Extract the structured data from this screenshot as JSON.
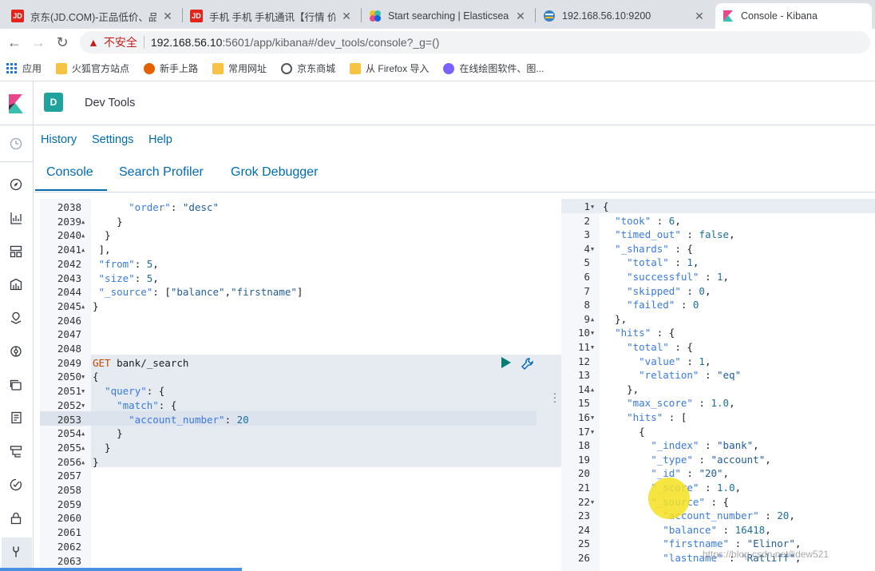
{
  "browser": {
    "tabs": [
      {
        "title": "京东(JD.COM)-正品低价、品质",
        "favicon": "JD",
        "color": "#e1251b"
      },
      {
        "title": "手机 手机 手机通讯【行情 价格",
        "favicon": "JD",
        "color": "#e1251b"
      },
      {
        "title": "Start searching | Elasticsearch",
        "favicon": "",
        "color": "#f4bd19"
      },
      {
        "title": "192.168.56.10:9200",
        "favicon": "",
        "color": "#3b82c4"
      },
      {
        "title": "Console - Kibana",
        "favicon": "K",
        "color": "#e8488b"
      }
    ],
    "address": {
      "warning": "不安全",
      "host": "192.168.56.10",
      "rest": ":5601/app/kibana#/dev_tools/console?_g=()"
    },
    "bookmarks": [
      "应用",
      "火狐官方站点",
      "新手上路",
      "常用网址",
      "京东商城",
      "从 Firefox 导入",
      "在线绘图软件、图..."
    ]
  },
  "kibana": {
    "space_initial": "D",
    "breadcrumb": "Dev Tools",
    "top_links": [
      "History",
      "Settings",
      "Help"
    ],
    "tabs": [
      "Console",
      "Search Profiler",
      "Grok Debugger"
    ],
    "active_tab": "Console"
  },
  "editor_lines": [
    {
      "n": "2038",
      "f": "",
      "code": "      \"order\": \"desc\""
    },
    {
      "n": "2039",
      "f": "▲",
      "code": "    }"
    },
    {
      "n": "2040",
      "f": "▲",
      "code": "  }"
    },
    {
      "n": "2041",
      "f": "▲",
      "code": " ],"
    },
    {
      "n": "2042",
      "f": "",
      "code": " \"from\": 5,"
    },
    {
      "n": "2043",
      "f": "",
      "code": " \"size\": 5,"
    },
    {
      "n": "2044",
      "f": "",
      "code": " \"_source\": [\"balance\",\"firstname\"]"
    },
    {
      "n": "2045",
      "f": "▲",
      "code": "}"
    },
    {
      "n": "2046",
      "f": "",
      "code": ""
    },
    {
      "n": "2047",
      "f": "",
      "code": ""
    },
    {
      "n": "2048",
      "f": "",
      "code": ""
    },
    {
      "n": "2049",
      "f": "",
      "code": "GET bank/_search"
    },
    {
      "n": "2050",
      "f": "▼",
      "code": "{"
    },
    {
      "n": "2051",
      "f": "▼",
      "code": "  \"query\": {"
    },
    {
      "n": "2052",
      "f": "▼",
      "code": "    \"match\": {"
    },
    {
      "n": "2053",
      "f": "",
      "code": "      \"account_number\": 20"
    },
    {
      "n": "2054",
      "f": "▲",
      "code": "    }"
    },
    {
      "n": "2055",
      "f": "▲",
      "code": "  }"
    },
    {
      "n": "2056",
      "f": "▲",
      "code": "}"
    },
    {
      "n": "2057",
      "f": "",
      "code": ""
    },
    {
      "n": "2058",
      "f": "",
      "code": ""
    },
    {
      "n": "2059",
      "f": "",
      "code": ""
    },
    {
      "n": "2060",
      "f": "",
      "code": ""
    },
    {
      "n": "2061",
      "f": "",
      "code": ""
    },
    {
      "n": "2062",
      "f": "",
      "code": ""
    },
    {
      "n": "2063",
      "f": "",
      "code": ""
    }
  ],
  "output_lines": [
    {
      "n": "1",
      "f": "▼",
      "code": "{"
    },
    {
      "n": "2",
      "f": "",
      "code": "  \"took\" : 6,"
    },
    {
      "n": "3",
      "f": "",
      "code": "  \"timed_out\" : false,"
    },
    {
      "n": "4",
      "f": "▼",
      "code": "  \"_shards\" : {"
    },
    {
      "n": "5",
      "f": "",
      "code": "    \"total\" : 1,"
    },
    {
      "n": "6",
      "f": "",
      "code": "    \"successful\" : 1,"
    },
    {
      "n": "7",
      "f": "",
      "code": "    \"skipped\" : 0,"
    },
    {
      "n": "8",
      "f": "",
      "code": "    \"failed\" : 0"
    },
    {
      "n": "9",
      "f": "▲",
      "code": "  },"
    },
    {
      "n": "10",
      "f": "▼",
      "code": "  \"hits\" : {"
    },
    {
      "n": "11",
      "f": "▼",
      "code": "    \"total\" : {"
    },
    {
      "n": "12",
      "f": "",
      "code": "      \"value\" : 1,"
    },
    {
      "n": "13",
      "f": "",
      "code": "      \"relation\" : \"eq\""
    },
    {
      "n": "14",
      "f": "▲",
      "code": "    },"
    },
    {
      "n": "15",
      "f": "",
      "code": "    \"max_score\" : 1.0,"
    },
    {
      "n": "16",
      "f": "▼",
      "code": "    \"hits\" : ["
    },
    {
      "n": "17",
      "f": "▼",
      "code": "      {"
    },
    {
      "n": "18",
      "f": "",
      "code": "        \"_index\" : \"bank\","
    },
    {
      "n": "19",
      "f": "",
      "code": "        \"_type\" : \"account\","
    },
    {
      "n": "20",
      "f": "",
      "code": "        \"_id\" : \"20\","
    },
    {
      "n": "21",
      "f": "",
      "code": "        \"_score\" : 1.0,"
    },
    {
      "n": "22",
      "f": "▼",
      "code": "        \"_source\" : {"
    },
    {
      "n": "23",
      "f": "",
      "code": "          \"account_number\" : 20,"
    },
    {
      "n": "24",
      "f": "",
      "code": "          \"balance\" : 16418,"
    },
    {
      "n": "25",
      "f": "",
      "code": "          \"firstname\" : \"Elinor\","
    },
    {
      "n": "26",
      "f": "",
      "code": "          \"lastname\" : \"Ratliff\","
    }
  ],
  "watermark": "https://blog.csdn.net/lidew521"
}
